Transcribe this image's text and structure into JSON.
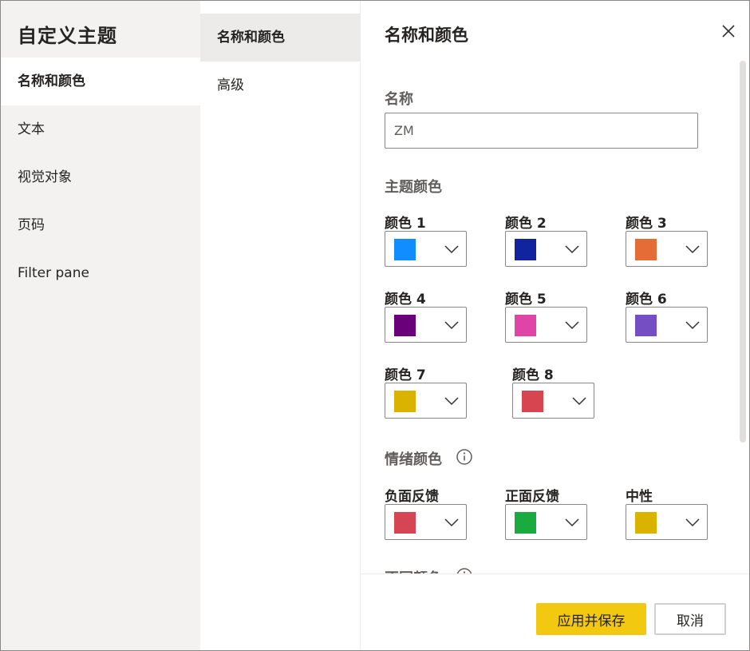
{
  "left_pane": {
    "title": "自定义主题",
    "items": [
      {
        "label": "名称和颜色",
        "active": true
      },
      {
        "label": "文本",
        "active": false
      },
      {
        "label": "视觉对象",
        "active": false
      },
      {
        "label": "页码",
        "active": false
      },
      {
        "label": "Filter pane",
        "active": false
      }
    ]
  },
  "mid_pane": {
    "items": [
      {
        "label": "名称和颜色",
        "active": true
      },
      {
        "label": "高级",
        "active": false
      }
    ]
  },
  "content": {
    "title": "名称和颜色",
    "close_icon": "close-icon",
    "name_label": "名称",
    "name_value": "ZM",
    "theme_colors_label": "主题颜色",
    "theme_colors": [
      {
        "label": "颜色 1",
        "color": "#118dff"
      },
      {
        "label": "颜色 2",
        "color": "#12239e"
      },
      {
        "label": "颜色 3",
        "color": "#e66c37"
      },
      {
        "label": "颜色 4",
        "color": "#6b007b"
      },
      {
        "label": "颜色 5",
        "color": "#e044a7"
      },
      {
        "label": "颜色 6",
        "color": "#744ec2"
      },
      {
        "label": "颜色 7",
        "color": "#d9b300"
      },
      {
        "label": "颜色 8",
        "color": "#d64550"
      }
    ],
    "sentiment_label": "情绪颜色",
    "sentiment_info_icon": "info-icon",
    "sentiment_colors": [
      {
        "label": "负面反馈",
        "color": "#d64554"
      },
      {
        "label": "正面反馈",
        "color": "#1aab40"
      },
      {
        "label": "中性",
        "color": "#d9b300"
      }
    ],
    "next_section_label": "不同颜色"
  },
  "footer": {
    "apply_label": "应用并保存",
    "cancel_label": "取消"
  }
}
